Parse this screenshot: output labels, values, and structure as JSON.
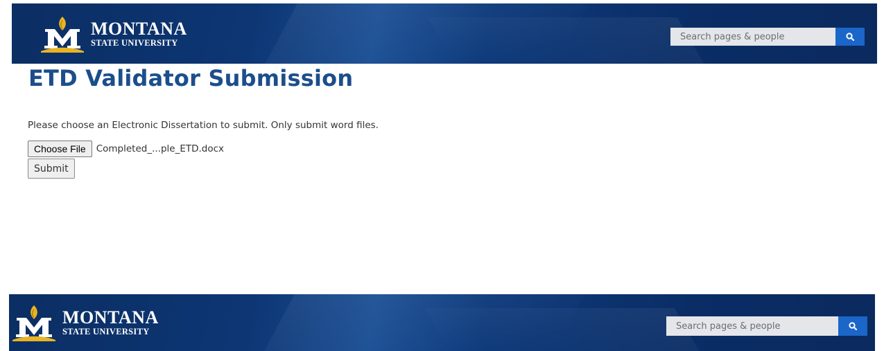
{
  "header": {
    "logo": {
      "name": "MONTANA",
      "subtitle": "STATE UNIVERSITY"
    },
    "search": {
      "placeholder": "Search pages & people",
      "button_icon": "search-icon"
    }
  },
  "main": {
    "title": "ETD Validator Submission",
    "instructions": "Please choose an Electronic Dissertation to submit. Only submit word files.",
    "file_input": {
      "button_label": "Choose File",
      "file_name": "Completed_...ple_ETD.docx"
    },
    "submit_label": "Submit"
  },
  "footer": {
    "logo": {
      "name": "MONTANA",
      "subtitle": "STATE UNIVERSITY"
    },
    "search": {
      "placeholder": "Search pages & people",
      "button_icon": "search-icon"
    }
  },
  "colors": {
    "banner_blue": "#0d3674",
    "title_blue": "#1c4e8c",
    "search_button_blue": "#1b66c9",
    "logo_gold": "#e8b423"
  }
}
